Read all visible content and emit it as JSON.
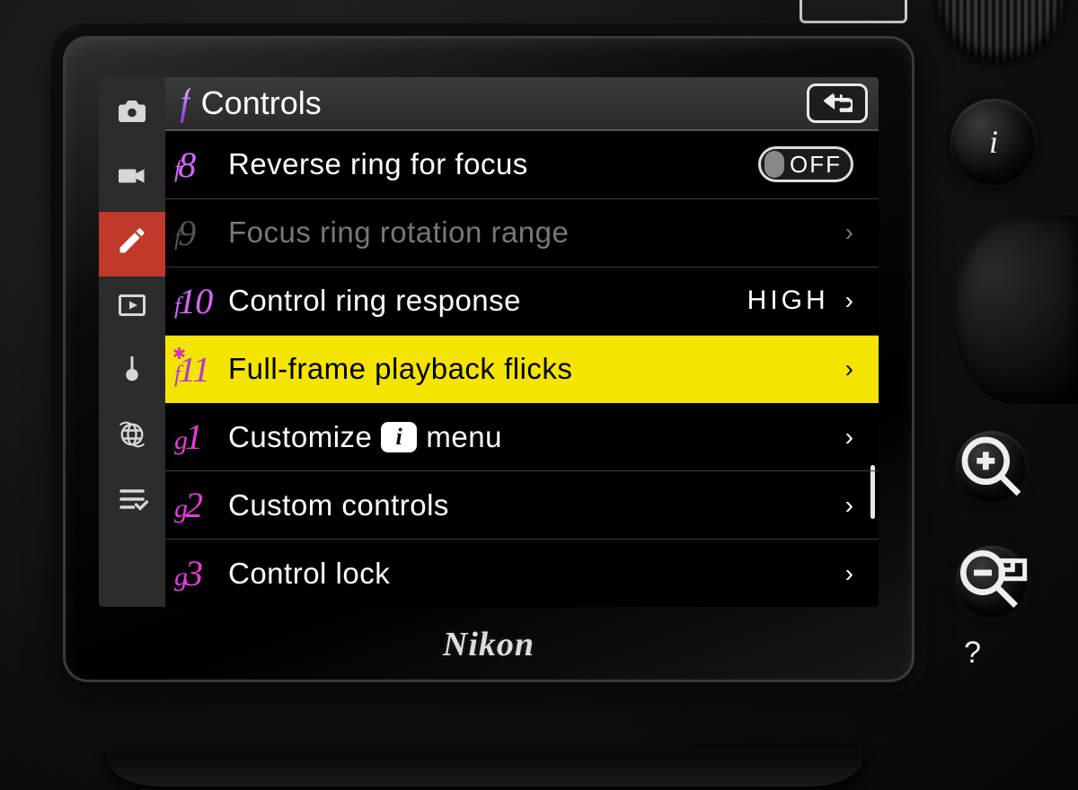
{
  "brand": "Nikon",
  "header": {
    "prefix_letter": "f",
    "title": "Controls"
  },
  "sidebar": {
    "tabs": [
      {
        "id": "photo",
        "icon": "camera",
        "active": false
      },
      {
        "id": "video",
        "icon": "video",
        "active": false
      },
      {
        "id": "custom",
        "icon": "pencil",
        "active": true
      },
      {
        "id": "playback",
        "icon": "play",
        "active": false
      },
      {
        "id": "setup",
        "icon": "wrench",
        "active": false
      },
      {
        "id": "network",
        "icon": "globe",
        "active": false
      },
      {
        "id": "mymenu",
        "icon": "list",
        "active": false
      }
    ]
  },
  "rows": [
    {
      "code_pre": "f",
      "code_num": "8",
      "group": "f",
      "label": "Reverse ring for focus",
      "value_type": "toggle_off",
      "value": "OFF",
      "chevron": false,
      "disabled": false,
      "highlight": false,
      "asterisk": false,
      "i_badge": false
    },
    {
      "code_pre": "f",
      "code_num": "9",
      "group": "f",
      "label": "Focus ring rotation range",
      "value_type": "none",
      "value": "",
      "chevron": true,
      "disabled": true,
      "highlight": false,
      "asterisk": false,
      "i_badge": false
    },
    {
      "code_pre": "f",
      "code_num": "10",
      "group": "f",
      "label": "Control ring response",
      "value_type": "text",
      "value": "HIGH",
      "chevron": true,
      "disabled": false,
      "highlight": false,
      "asterisk": false,
      "i_badge": false
    },
    {
      "code_pre": "f",
      "code_num": "11",
      "group": "f",
      "label": "Full-frame playback flicks",
      "value_type": "none",
      "value": "",
      "chevron": true,
      "disabled": false,
      "highlight": true,
      "asterisk": true,
      "i_badge": false
    },
    {
      "code_pre": "g",
      "code_num": "1",
      "group": "g",
      "label_pre": "Customize",
      "label_post": "menu",
      "value_type": "none",
      "value": "",
      "chevron": true,
      "disabled": false,
      "highlight": false,
      "asterisk": false,
      "i_badge": true
    },
    {
      "code_pre": "g",
      "code_num": "2",
      "group": "g",
      "label": "Custom controls",
      "value_type": "none",
      "value": "",
      "chevron": true,
      "disabled": false,
      "highlight": false,
      "asterisk": false,
      "i_badge": false
    },
    {
      "code_pre": "g",
      "code_num": "3",
      "group": "g",
      "label": "Control lock",
      "value_type": "none",
      "value": "",
      "chevron": true,
      "disabled": false,
      "highlight": false,
      "asterisk": false,
      "i_badge": false
    }
  ],
  "physical_buttons": {
    "info": "i",
    "zoom_in": "+",
    "zoom_out": "−",
    "help": "?"
  }
}
